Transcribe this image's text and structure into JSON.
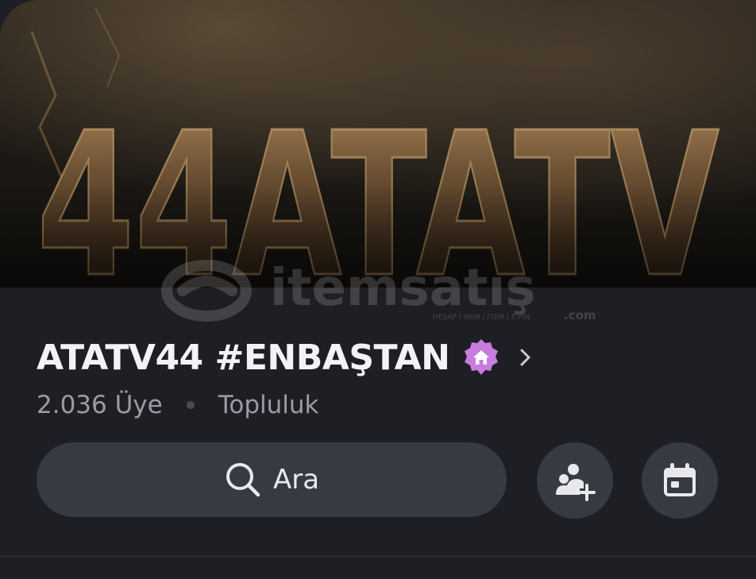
{
  "banner": {
    "title_art": "44ATATV"
  },
  "watermark": {
    "brand": "itemsatış",
    "tagline": "HESAP / SKIN / ITEM / E-PIN",
    "suffix": ".com"
  },
  "server": {
    "name": "ATATV44 #ENBAŞTAN",
    "badge_icon": "home-icon",
    "badge_color": "#c77dde",
    "member_count": "2.036 Üye",
    "type": "Topluluk"
  },
  "search": {
    "label": "Ara",
    "icon": "search-icon"
  },
  "actions": {
    "invite_icon": "add-member-icon",
    "events_icon": "calendar-icon"
  },
  "colors": {
    "background": "#1e1f24",
    "button": "#383a43",
    "text_primary": "#f2f3f5",
    "text_secondary": "#9a9ca4"
  }
}
